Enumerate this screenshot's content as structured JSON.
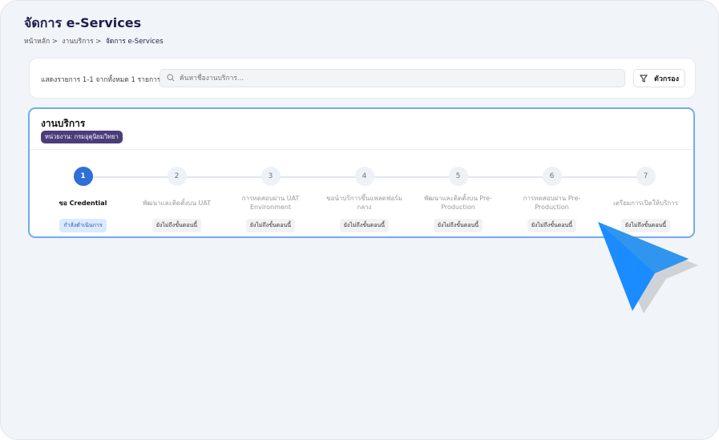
{
  "header": {
    "title": "จัดการ e-Services",
    "breadcrumb": [
      "หน้าหลัก",
      "งานบริการ",
      "จัดการ e-Services"
    ]
  },
  "toolbar": {
    "count_text": "แสดงรายการ 1-1 จากทั้งหมด 1 รายการ",
    "search_placeholder": "ค้นหาชื่องานบริการ...",
    "search_value": "",
    "filter_label": "ตัวกรอง"
  },
  "service": {
    "title": "งานบริการ",
    "agency": "หน่วยงาน: กรมอุตุนิยมวิทยา",
    "steps": [
      {
        "n": "1",
        "label": "ขอ Credential",
        "status": "กำลังดำเนินการ",
        "active": true
      },
      {
        "n": "2",
        "label": "พัฒนาและติดตั้งบน UAT",
        "status": "ยังไม่ถึงขั้นตอนนี้"
      },
      {
        "n": "3",
        "label": "การทดสอบผ่าน UAT Environment",
        "status": "ยังไม่ถึงขั้นตอนนี้"
      },
      {
        "n": "4",
        "label": "ขอนำบริการขึ้นแพลตฟอร์มกลาง",
        "status": "ยังไม่ถึงขั้นตอนนี้"
      },
      {
        "n": "5",
        "label": "พัฒนาและติดตั้งบน Pre-Production",
        "status": "ยังไม่ถึงขั้นตอนนี้"
      },
      {
        "n": "6",
        "label": "การทดสอบผ่าน Pre-Production",
        "status": "ยังไม่ถึงขั้นตอนนี้"
      },
      {
        "n": "7",
        "label": "เตรียมการเปิดให้บริการ",
        "status": "ยังไม่ถึงขั้นตอนนี้"
      }
    ]
  },
  "colors": {
    "accent": "#2f6fd6",
    "card_border": "#74aaf0",
    "agency_badge": "#4a3d7a",
    "cursor": "#1a8cff"
  }
}
